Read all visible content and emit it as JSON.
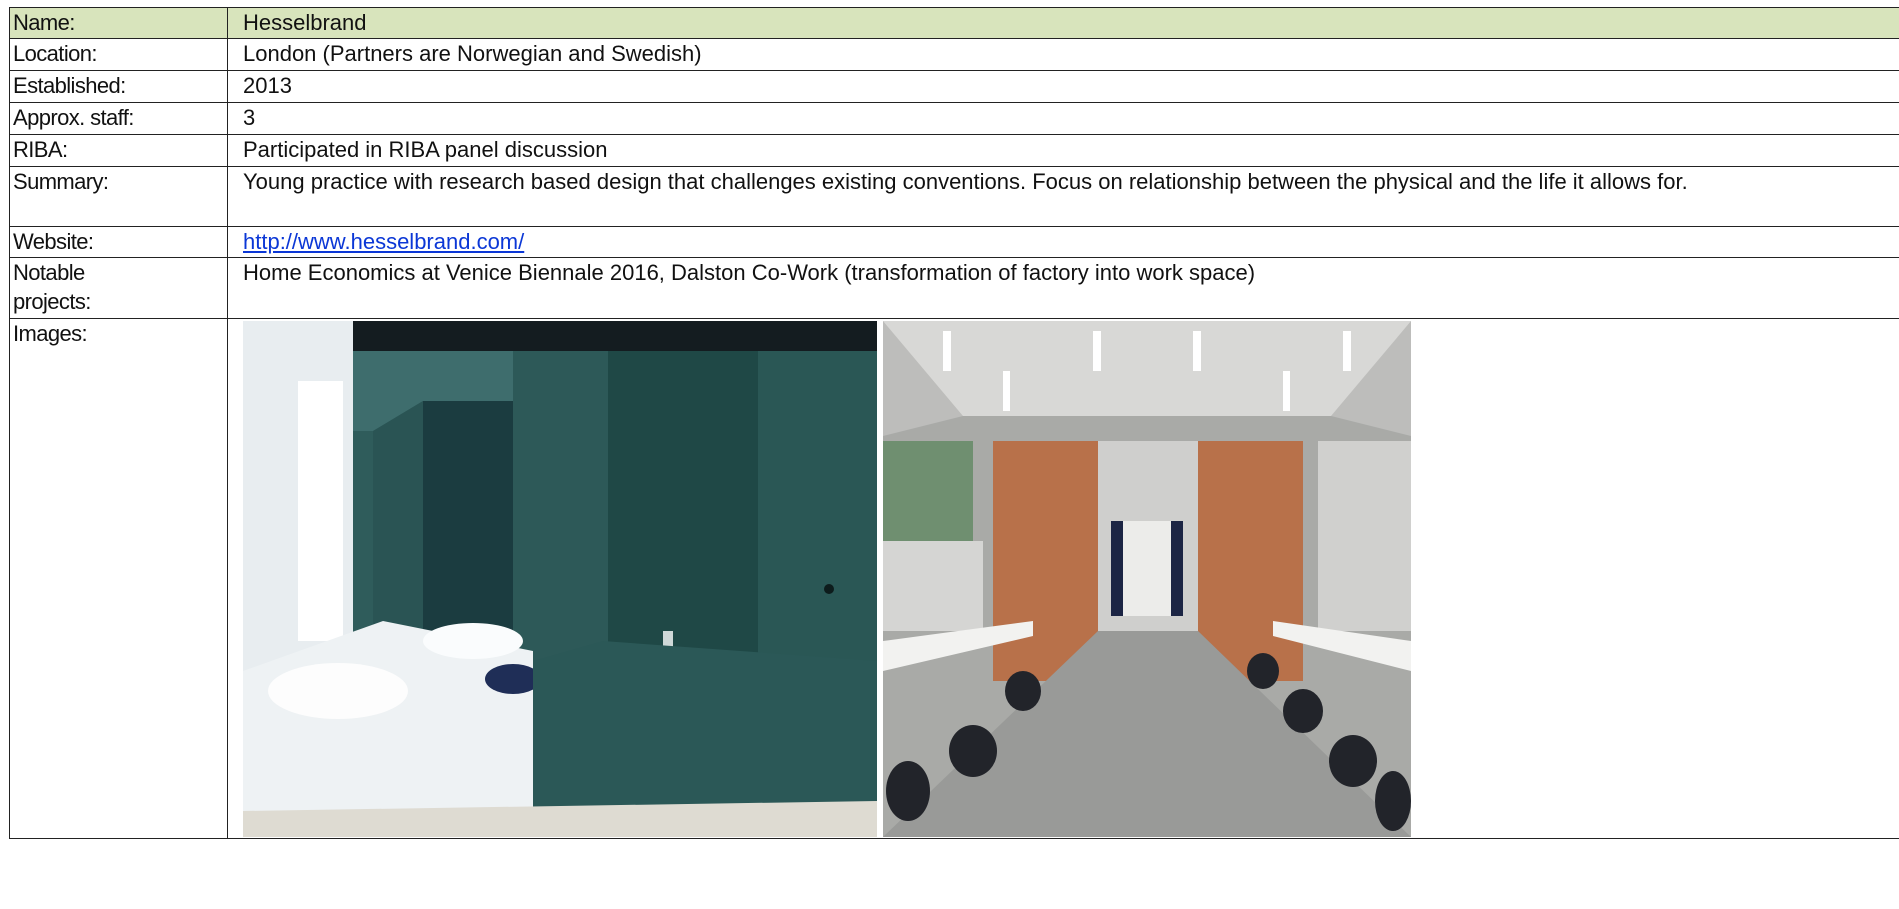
{
  "rows": {
    "name": {
      "label": "Name:",
      "value": "Hesselbrand"
    },
    "location": {
      "label": "Location:",
      "value": "London (Partners are Norwegian and Swedish)"
    },
    "established": {
      "label": "Established:",
      "value": "2013"
    },
    "staff": {
      "label": "Approx. staff:",
      "value": "3"
    },
    "riba": {
      "label": "RIBA:",
      "value": "Participated in RIBA panel discussion"
    },
    "summary": {
      "label": "Summary:",
      "value": "Young practice with research based design that challenges existing conventions. Focus on relationship between the physical and the life it allows for."
    },
    "website": {
      "label": "Website:",
      "value": "http://www.hesselbrand.com/"
    },
    "projects": {
      "label": "Notable projects:",
      "value": "Home Economics at Venice Biennale 2016, Dalston Co-Work (transformation of factory into work space)"
    },
    "images": {
      "label": "Images:"
    }
  },
  "colors": {
    "header_bg": "#d8e4bc",
    "link": "#0b37d6"
  }
}
